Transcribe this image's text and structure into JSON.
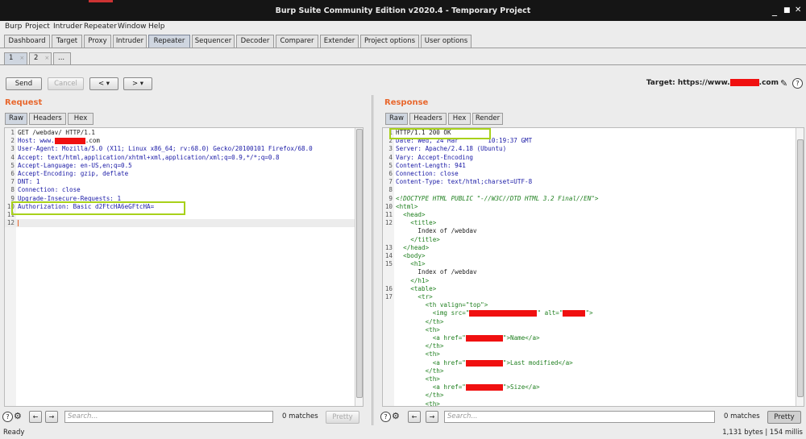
{
  "window": {
    "title": "Burp Suite Community Edition v2020.4 - Temporary Project",
    "min": "_",
    "max": "■",
    "close": "✕"
  },
  "menu": [
    "Burp",
    "Project",
    "Intruder",
    "Repeater",
    "Window",
    "Help"
  ],
  "tabs": [
    "Dashboard",
    "Target",
    "Proxy",
    "Intruder",
    "Repeater",
    "Sequencer",
    "Decoder",
    "Comparer",
    "Extender",
    "Project options",
    "User options"
  ],
  "active_tab": "Repeater",
  "subtabs": [
    {
      "label": "1",
      "close": "×"
    },
    {
      "label": "2",
      "close": "×"
    },
    {
      "label": "..."
    }
  ],
  "toolbar": {
    "send": "Send",
    "cancel": "Cancel",
    "back": "< ▾",
    "forward": "> ▾",
    "target_label": "Target: https://www.",
    "target_suffix": ".com",
    "edit_icon": "✎",
    "help_icon": "?"
  },
  "request": {
    "title": "Request",
    "tabs": [
      "Raw",
      "Headers",
      "Hex"
    ],
    "lines": [
      "GET /webdav/ HTTP/1.1",
      "Host: www.",
      "User-Agent: Mozilla/5.0 (X11; Linux x86_64; rv:68.0) Gecko/20100101 Firefox/68.0",
      "Accept: text/html,application/xhtml+xml,application/xml;q=0.9,*/*;q=0.8",
      "Accept-Language: en-US,en;q=0.5",
      "Accept-Encoding: gzip, deflate",
      "DNT: 1",
      "Connection: close",
      "Upgrade-Insecure-Requests: 1",
      "Authorization: Basic d2FtcHA6eGFtcHA=",
      "",
      ""
    ],
    "host_suffix": ".com",
    "search_placeholder": "Search...",
    "matches": "0 matches",
    "pretty": "Pretty"
  },
  "response": {
    "title": "Response",
    "tabs": [
      "Raw",
      "Headers",
      "Hex",
      "Render"
    ],
    "lines": [
      "HTTP/1.1 200 OK",
      "Date: Wed, 24 Mar        10:19:37 GMT",
      "Server: Apache/2.4.18 (Ubuntu)",
      "Vary: Accept-Encoding",
      "Content-Length: 941",
      "Connection: close",
      "Content-Type: text/html;charset=UTF-8",
      "",
      "<!DOCTYPE HTML PUBLIC \"-//W3C//DTD HTML 3.2 Final//EN\">",
      "<html>",
      "  <head>",
      "    <title>",
      "      Index of /webdav",
      "    </title>",
      "  </head>",
      "  <body>",
      "    <h1>",
      "      Index of /webdav",
      "    </h1>",
      "    <table>",
      "      <tr>",
      "        <th valign=\"top\">",
      "          <img src=\"\" alt=\"\">",
      "        </th>",
      "        <th>",
      "          <a href=\"\">Name</a>",
      "        </th>",
      "        <th>",
      "          <a href=\"\">Last modified</a>",
      "        </th>",
      "        <th>",
      "          <a href=\"\">Size</a>",
      "        </th>",
      "        <th>"
    ],
    "line_numbers": [
      "1",
      "2",
      "3",
      "4",
      "5",
      "6",
      "7",
      "8",
      "9",
      "10",
      "11",
      "12",
      "",
      "",
      "13",
      "14",
      "15",
      "",
      "",
      "16",
      "17",
      "",
      "",
      "",
      "",
      "",
      "",
      "",
      "",
      "",
      "",
      "",
      "",
      ""
    ],
    "search_placeholder": "Search...",
    "matches": "0 matches",
    "pretty": "Pretty"
  },
  "status": {
    "left": "Ready",
    "right": "1,131 bytes | 154 millis"
  },
  "colors": {
    "accent": "#e8672d",
    "highlight": "#a8d11a",
    "redaction": "#f01010"
  }
}
